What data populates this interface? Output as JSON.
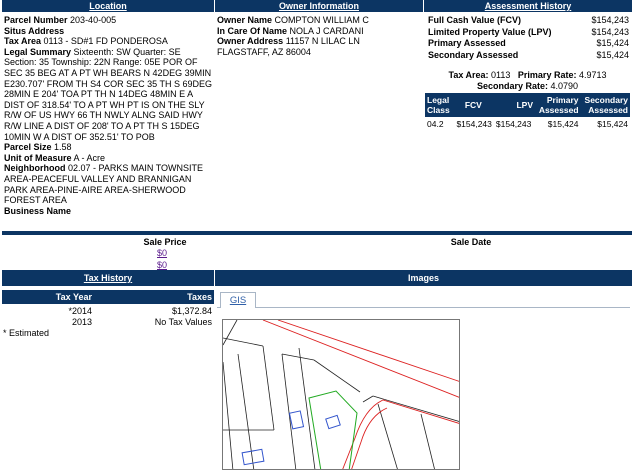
{
  "headers": {
    "location": "Location",
    "owner_information": "Owner Information",
    "assessment_history": "Assessment History",
    "tax_history": "Tax History",
    "images": "Images"
  },
  "location": {
    "parcel_number_label": "Parcel Number",
    "parcel_number": "203-40-005",
    "situs_address_label": "Situs Address",
    "tax_area_label": "Tax Area",
    "tax_area": "0113 - SD#1 FD PONDEROSA",
    "legal_summary_label": "Legal Summary",
    "legal_summary": "Sixteenth: SW Quarter: SE Section: 35 Township: 22N Range: 05E POR OF SEC 35 BEG AT A PT WH BEARS N 42DEG 39MIN E230.707' FROM TH S4 COR SEC 35 TH S 69DEG 28MIN E 204' TOA PT TH N 14DEG 48MIN E A DIST OF 318.54' TO A PT WH PT IS ON THE SLY R/W OF US HWY 66 TH NWLY ALNG SAID HWY R/W LINE A DIST OF 208' TO A PT TH S 15DEG 10MIN W A DIST OF 352.51' TO POB",
    "parcel_size_label": "Parcel Size",
    "parcel_size": "1.58",
    "unit_of_measure_label": "Unit of Measure",
    "unit_of_measure": "A - Acre",
    "neighborhood_label": "Neighborhood",
    "neighborhood": "02.07 - PARKS MAIN TOWNSITE AREA-PEACEFUL VALLEY AND BRANNIGAN PARK AREA-PINE-AIRE AREA-SHERWOOD FOREST AREA",
    "business_name_label": "Business Name"
  },
  "owner": {
    "owner_name_label": "Owner Name",
    "owner_name": "COMPTON WILLIAM C",
    "in_care_of_label": "In Care Of Name",
    "in_care_of": "NOLA J CARDANI",
    "owner_address_label": "Owner Address",
    "owner_address_line1": "11157 N LILAC LN",
    "owner_address_line2": "FLAGSTAFF, AZ 86004"
  },
  "assessment": {
    "fcv_label": "Full Cash Value (FCV)",
    "fcv": "$154,243",
    "lpv_label": "Limited Property Value (LPV)",
    "lpv": "$154,243",
    "primary_label": "Primary Assessed",
    "primary": "$15,424",
    "secondary_label": "Secondary Assessed",
    "secondary": "$15,424",
    "tax_area_label": "Tax Area:",
    "tax_area": "0113",
    "primary_rate_label": "Primary Rate:",
    "primary_rate": "4.9713",
    "secondary_rate_label": "Secondary Rate:",
    "secondary_rate": "4.0790",
    "table": {
      "headers": {
        "legal_class_1": "Legal",
        "legal_class_2": "Class",
        "fcv": "FCV",
        "lpv": "LPV",
        "primary_1": "Primary",
        "primary_2": "Assessed",
        "secondary_1": "Secondary",
        "secondary_2": "Assessed"
      },
      "row": {
        "legal_class": "04.2",
        "fcv": "$154,243",
        "lpv": "$154,243",
        "primary": "$15,424",
        "secondary": "$15,424"
      }
    }
  },
  "sales": {
    "sale_price_label": "Sale Price",
    "sale_date_label": "Sale Date",
    "prices": [
      "$0",
      "$0"
    ]
  },
  "tax_history": {
    "year_label": "Tax Year",
    "taxes_label": "Taxes",
    "rows": [
      {
        "year": "*2014",
        "taxes": "$1,372.84"
      },
      {
        "year": "2013",
        "taxes": "No Tax Values"
      }
    ],
    "footnote": "* Estimated"
  },
  "images": {
    "tab_label": "GIS"
  },
  "colors": {
    "header_blue": "#0c3563",
    "link_purple": "#5a1a8c",
    "parcel_green": "#22aa22",
    "road_red": "#dd2222",
    "building_blue": "#3355cc"
  }
}
